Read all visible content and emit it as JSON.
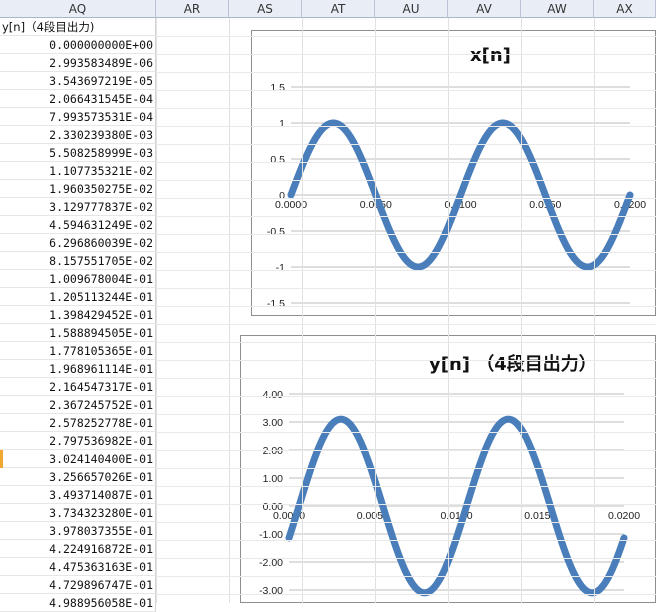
{
  "sheet": {
    "columns": [
      "AQ",
      "AR",
      "AS",
      "AT",
      "AU",
      "AV",
      "AW",
      "AX"
    ],
    "column_header": "y[n]（4段目出力)",
    "values": [
      "0.000000000E+00",
      "2.993583489E-06",
      "3.543697219E-05",
      "2.066431545E-04",
      "7.993573531E-04",
      "2.330239380E-03",
      "5.508258999E-03",
      "1.107735321E-02",
      "1.960350275E-02",
      "3.129777837E-02",
      "4.594631249E-02",
      "6.296860039E-02",
      "8.157551705E-02",
      "1.009678004E-01",
      "1.205113244E-01",
      "1.398429452E-01",
      "1.588894505E-01",
      "1.778105365E-01",
      "1.968961114E-01",
      "2.164547317E-01",
      "2.367245752E-01",
      "2.578252778E-01",
      "2.797536982E-01",
      "3.024140400E-01",
      "3.256657026E-01",
      "3.493714087E-01",
      "3.734323280E-01",
      "3.978037355E-01",
      "4.224916872E-01",
      "4.475363163E-01",
      "4.729896747E-01",
      "4.988956058E-01"
    ]
  },
  "charts": {
    "x_chart": {
      "title": "x[n]"
    },
    "y_chart": {
      "title": "y[n] （4段目出力）"
    }
  },
  "chart_data": [
    {
      "type": "scatter",
      "title": "x[n]",
      "x_ticks": [
        "0.0000",
        "0.0050",
        "0.0100",
        "0.0150",
        "0.0200"
      ],
      "y_ticks": [
        "1.5",
        "1",
        "0.5",
        "0",
        "-0.5",
        "-1",
        "-1.5"
      ],
      "xlim": [
        0,
        0.02
      ],
      "ylim": [
        -1.5,
        1.5
      ],
      "series": [
        {
          "function": "sin(2*pi*100*t)",
          "t_range": [
            0,
            0.02
          ]
        }
      ],
      "color": "#4a7ebb",
      "grid": true
    },
    {
      "type": "scatter",
      "title": "y[n] （4段目出力）",
      "x_ticks": [
        "0.0000",
        "0.0050",
        "0.0100",
        "0.0150",
        "0.0200"
      ],
      "y_ticks": [
        "4.00",
        "3.00",
        "2.00",
        "1.00",
        "0.00",
        "-1.00",
        "-2.00",
        "-3.00"
      ],
      "xlim": [
        0,
        0.02
      ],
      "ylim": [
        -3.0,
        4.0
      ],
      "series": [
        {
          "function": "3.1*sin(2*pi*100*(t-0.0006))",
          "t_range": [
            0,
            0.02
          ]
        }
      ],
      "color": "#4a7ebb",
      "grid": true
    }
  ]
}
